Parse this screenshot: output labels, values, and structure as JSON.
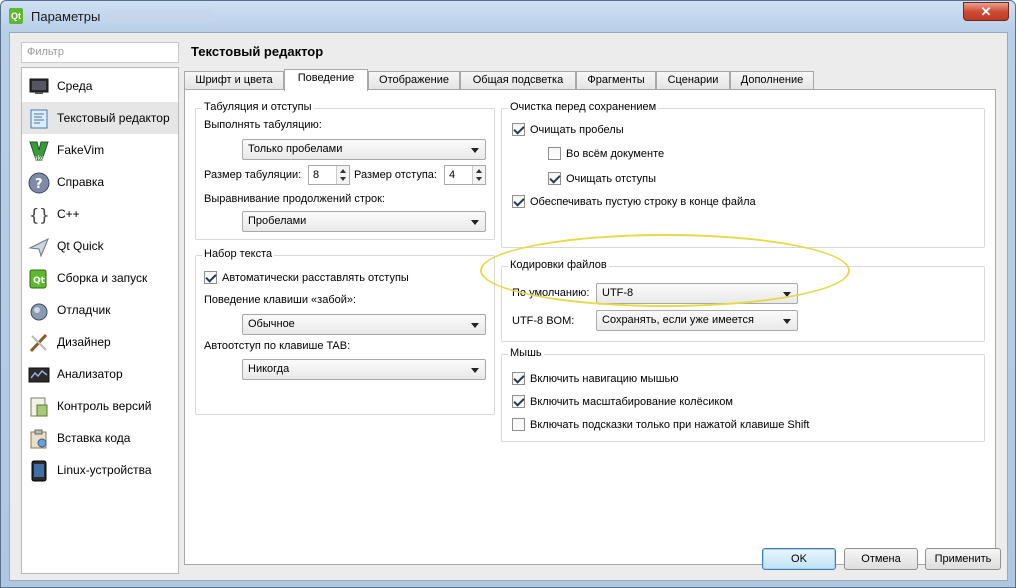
{
  "window": {
    "title": "Параметры",
    "icon": "qt-icon",
    "close_label": "✕"
  },
  "filter": {
    "placeholder": "Фильтр"
  },
  "sidebar": {
    "items": [
      {
        "label": "Среда",
        "icon": "monitor-icon"
      },
      {
        "label": "Текстовый редактор",
        "icon": "text-editor-icon",
        "selected": true
      },
      {
        "label": "FakeVim",
        "icon": "fakevim-icon"
      },
      {
        "label": "Справка",
        "icon": "help-icon"
      },
      {
        "label": "C++",
        "icon": "cpp-braces-icon"
      },
      {
        "label": "Qt Quick",
        "icon": "qt-quick-icon"
      },
      {
        "label": "Сборка и запуск",
        "icon": "build-run-icon"
      },
      {
        "label": "Отладчик",
        "icon": "debugger-icon"
      },
      {
        "label": "Дизайнер",
        "icon": "designer-icon"
      },
      {
        "label": "Анализатор",
        "icon": "analyzer-icon"
      },
      {
        "label": "Контроль версий",
        "icon": "version-control-icon"
      },
      {
        "label": "Вставка кода",
        "icon": "code-paste-icon"
      },
      {
        "label": "Linux-устройства",
        "icon": "linux-device-icon"
      }
    ]
  },
  "page_title": "Текстовый редактор",
  "tabs": [
    {
      "label": "Шрифт и цвета"
    },
    {
      "label": "Поведение",
      "active": true
    },
    {
      "label": "Отображение"
    },
    {
      "label": "Общая подсветка"
    },
    {
      "label": "Фрагменты"
    },
    {
      "label": "Сценарии"
    },
    {
      "label": "Дополнение"
    }
  ],
  "tabulation": {
    "title": "Табуляция и отступы",
    "tab_policy_label": "Выполнять табуляцию:",
    "tab_policy_value": "Только пробелами",
    "tab_size_label": "Размер табуляции:",
    "tab_size_value": "8",
    "indent_size_label": "Размер отступа:",
    "indent_size_value": "4",
    "continuation_label": "Выравнивание продолжений строк:",
    "continuation_value": "Пробелами"
  },
  "typing": {
    "title": "Набор текста",
    "auto_indent_label": "Автоматически расставлять отступы",
    "auto_indent_checked": true,
    "backspace_label": "Поведение клавиши «забой»:",
    "backspace_value": "Обычное",
    "tab_key_label": "Автоотступ по клавише TAB:",
    "tab_key_value": "Никогда"
  },
  "cleanup": {
    "title": "Очистка перед сохранением",
    "clean_ws_label": "Очищать пробелы",
    "clean_ws_checked": true,
    "entire_doc_label": "Во всём документе",
    "entire_doc_checked": false,
    "clean_indent_label": "Очищать отступы",
    "clean_indent_checked": true,
    "trailing_line_label": "Обеспечивать пустую строку в конце файла",
    "trailing_line_checked": true
  },
  "encodings": {
    "title": "Кодировки файлов",
    "default_label": "По умолчанию:",
    "default_value": "UTF-8",
    "bom_label": "UTF-8 BOM:",
    "bom_value": "Сохранять, если уже имеется",
    "highlight_color": "#e6d94a"
  },
  "mouse": {
    "title": "Мышь",
    "nav_label": "Включить навигацию мышью",
    "nav_checked": true,
    "wheel_label": "Включить масштабирование колёсиком",
    "wheel_checked": true,
    "tooltips_label": "Включать подсказки только при нажатой клавише Shift",
    "tooltips_checked": false
  },
  "buttons": {
    "ok": "OK",
    "cancel": "Отмена",
    "apply": "Применить"
  }
}
